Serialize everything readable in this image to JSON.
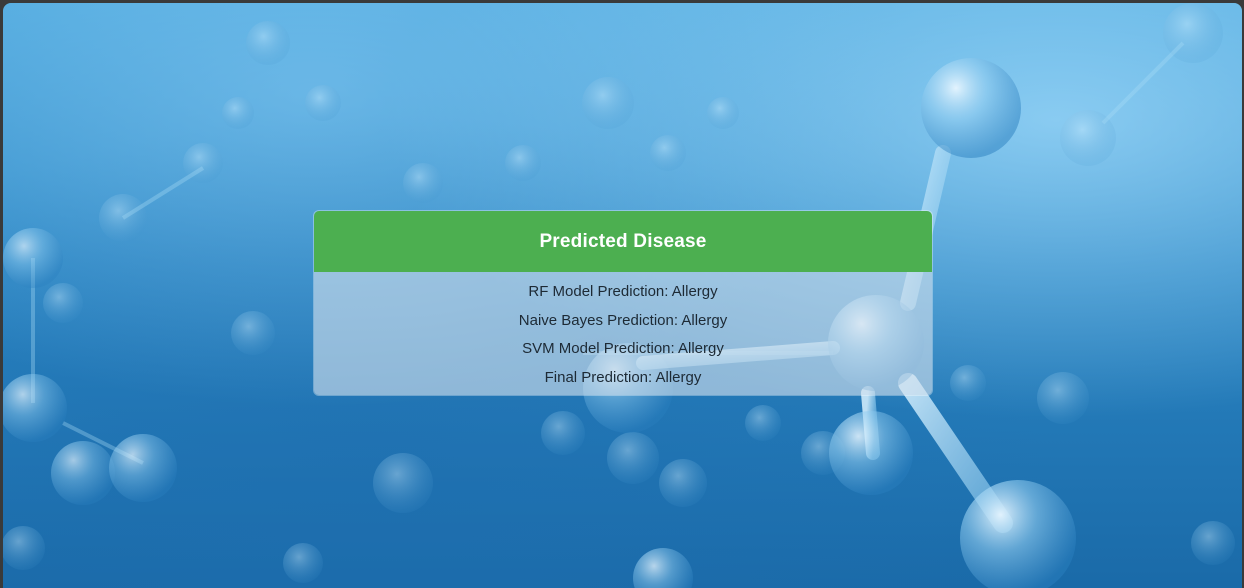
{
  "result_panel": {
    "title": "Predicted Disease",
    "predictions": [
      "RF Model Prediction: Allergy",
      "Naive Bayes Prediction: Allergy",
      "SVM Model Prediction: Allergy",
      "Final Prediction: Allergy"
    ],
    "header_color": "#4caf50"
  },
  "background": {
    "theme": "molecule-bubbles",
    "primary_color": "#2b86c4"
  }
}
